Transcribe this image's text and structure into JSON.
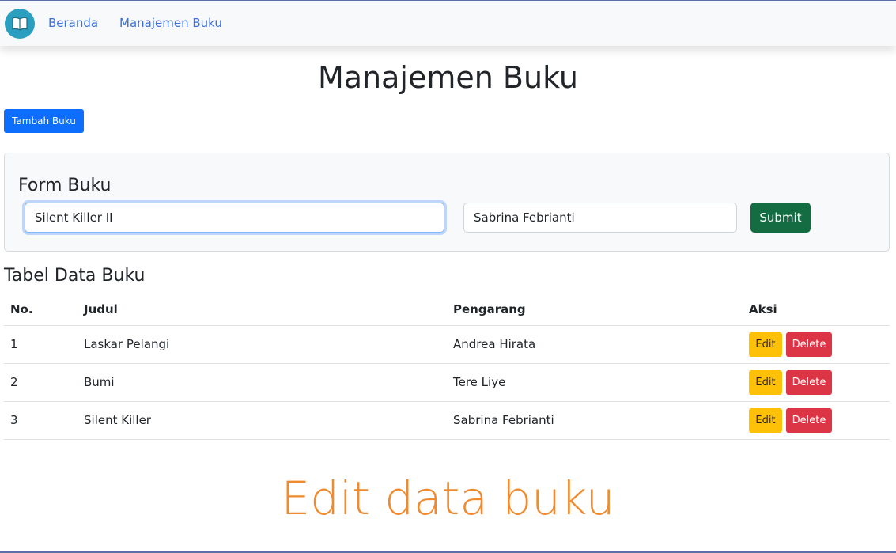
{
  "nav": {
    "brand_icon": "book-icon",
    "links": [
      "Beranda",
      "Manajemen Buku"
    ]
  },
  "page": {
    "title": "Manajemen Buku",
    "add_button": "Tambah Buku"
  },
  "form": {
    "title": "Form Buku",
    "judul_value": "Silent Killer II",
    "pengarang_value": "Sabrina Febrianti",
    "submit_label": "Submit"
  },
  "table": {
    "title": "Tabel Data Buku",
    "headers": [
      "No.",
      "Judul",
      "Pengarang",
      "Aksi"
    ],
    "rows": [
      {
        "no": "1",
        "judul": "Laskar Pelangi",
        "pengarang": "Andrea Hirata"
      },
      {
        "no": "2",
        "judul": "Bumi",
        "pengarang": "Tere Liye"
      },
      {
        "no": "3",
        "judul": "Silent Killer",
        "pengarang": "Sabrina Febrianti"
      }
    ],
    "edit_label": "Edit",
    "delete_label": "Delete"
  },
  "caption": "Edit data buku",
  "colors": {
    "primary": "#0d6efd",
    "success": "#146c43",
    "warning": "#ffc107",
    "danger": "#dc3545",
    "caption": "#f08a2e"
  }
}
